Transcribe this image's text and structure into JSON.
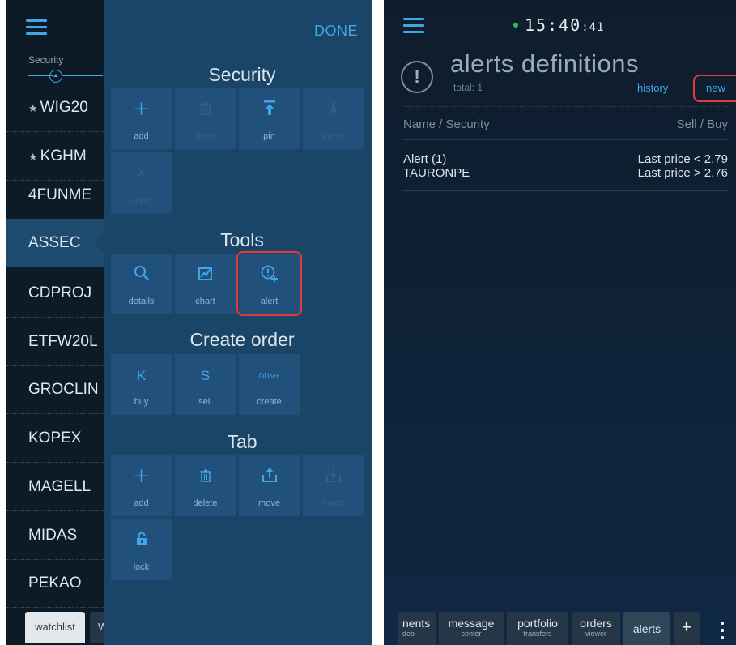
{
  "left": {
    "security_column_label": "Security",
    "watchlist": [
      {
        "name": "WIG20",
        "pinned": true
      },
      {
        "name": "KGHM",
        "pinned": true
      },
      {
        "name": "4FUNME",
        "pinned": false
      },
      {
        "name": "ASSEC",
        "pinned": false,
        "selected": true
      },
      {
        "name": "CDPROJ",
        "pinned": false
      },
      {
        "name": "ETFW20L",
        "pinned": false
      },
      {
        "name": "GROCLIN",
        "pinned": false
      },
      {
        "name": "KOPEX",
        "pinned": false
      },
      {
        "name": "MAGELL",
        "pinned": false
      },
      {
        "name": "MIDAS",
        "pinned": false
      },
      {
        "name": "PEKAO",
        "pinned": false
      }
    ],
    "bottom_tabs": [
      "watchlist",
      "W"
    ],
    "panel": {
      "done": "DONE",
      "sections": {
        "security": {
          "title": "Security",
          "actions": [
            {
              "label": "add",
              "icon": "plus-icon",
              "enabled": true
            },
            {
              "label": "delete",
              "icon": "trash-icon",
              "enabled": false
            },
            {
              "label": "pin",
              "icon": "pin-top-icon",
              "enabled": true
            },
            {
              "label": "move",
              "icon": "arrow-down-icon",
              "enabled": false
            },
            {
              "label": "unpin",
              "icon": "unpin-icon",
              "enabled": false
            }
          ]
        },
        "tools": {
          "title": "Tools",
          "actions": [
            {
              "label": "details",
              "icon": "search-icon",
              "enabled": true
            },
            {
              "label": "chart",
              "icon": "chart-icon",
              "enabled": true
            },
            {
              "label": "alert",
              "icon": "alert-plus-icon",
              "enabled": true,
              "highlighted": true
            }
          ]
        },
        "create_order": {
          "title": "Create order",
          "actions": [
            {
              "label": "buy",
              "glyph": "K",
              "enabled": true
            },
            {
              "label": "sell",
              "glyph": "S",
              "enabled": true
            },
            {
              "label": "create",
              "glyph": "DDM+",
              "enabled": true
            }
          ]
        },
        "tab": {
          "title": "Tab",
          "actions": [
            {
              "label": "add",
              "icon": "plus-icon",
              "enabled": true
            },
            {
              "label": "delete",
              "icon": "trash-icon",
              "enabled": true
            },
            {
              "label": "move",
              "icon": "upload-icon",
              "enabled": true
            },
            {
              "label": "insert",
              "icon": "download-icon",
              "enabled": false
            },
            {
              "label": "lock",
              "icon": "lock-icon",
              "enabled": true
            }
          ]
        }
      }
    }
  },
  "right": {
    "clock_hm": "15:40",
    "clock_sec": ":41",
    "title": "alerts definitions",
    "total": "total: 1",
    "history": "history",
    "new": "new",
    "columns": {
      "left": "Name / Security",
      "right": "Sell / Buy"
    },
    "alerts": [
      {
        "name": "Alert (1)",
        "security": "TAURONPE",
        "sell": "Last price < 2.79",
        "buy": "Last price > 2.76"
      }
    ],
    "tabs": [
      {
        "label": "nents",
        "sub": "deo"
      },
      {
        "label": "message",
        "sub": "center"
      },
      {
        "label": "portfolio",
        "sub": "transfers"
      },
      {
        "label": "orders",
        "sub": "viewer"
      },
      {
        "label": "alerts",
        "sub": "",
        "active": true
      }
    ],
    "plus": "+"
  },
  "colors": {
    "accent": "#3fa7e8",
    "highlight": "#e03a3a",
    "panel": "#1a4567",
    "tile": "#21507a",
    "online": "#25c25a"
  }
}
